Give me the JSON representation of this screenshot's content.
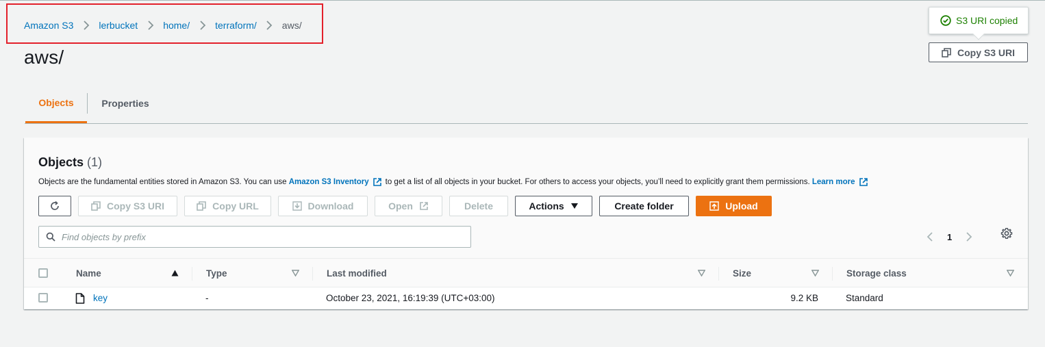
{
  "breadcrumb": {
    "items": [
      "Amazon S3",
      "lerbucket",
      "home/",
      "terraform/"
    ],
    "current": "aws/"
  },
  "page": {
    "title": "aws/"
  },
  "toast": {
    "message": "S3 URI copied"
  },
  "header_actions": {
    "copy_s3_uri": "Copy S3 URI"
  },
  "tabs": [
    {
      "label": "Objects",
      "active": true
    },
    {
      "label": "Properties",
      "active": false
    }
  ],
  "objects_panel": {
    "title": "Objects",
    "count": "(1)",
    "description_prefix": "Objects are the fundamental entities stored in Amazon S3. You can use",
    "inventory_link": "Amazon S3 Inventory",
    "description_suffix": "to get a list of all objects in your bucket. For others to access your objects, you’ll need to explicitly grant them permissions.",
    "learn_more": "Learn more"
  },
  "toolbar": {
    "copy_s3_uri": "Copy S3 URI",
    "copy_url": "Copy URL",
    "download": "Download",
    "open": "Open",
    "delete": "Delete",
    "actions": "Actions",
    "create_folder": "Create folder",
    "upload": "Upload"
  },
  "search": {
    "placeholder": "Find objects by prefix",
    "value": ""
  },
  "pagination": {
    "current_page": "1"
  },
  "table": {
    "columns": [
      "Name",
      "Type",
      "Last modified",
      "Size",
      "Storage class"
    ],
    "rows": [
      {
        "name": "key",
        "type": "-",
        "last_modified": "October 23, 2021, 16:19:39 (UTC+03:00)",
        "size": "9.2 KB",
        "storage_class": "Standard"
      }
    ]
  },
  "colors": {
    "accent": "#ec7211",
    "link": "#0073bb",
    "success": "#1d8102",
    "highlight_box": "#e3202a"
  }
}
